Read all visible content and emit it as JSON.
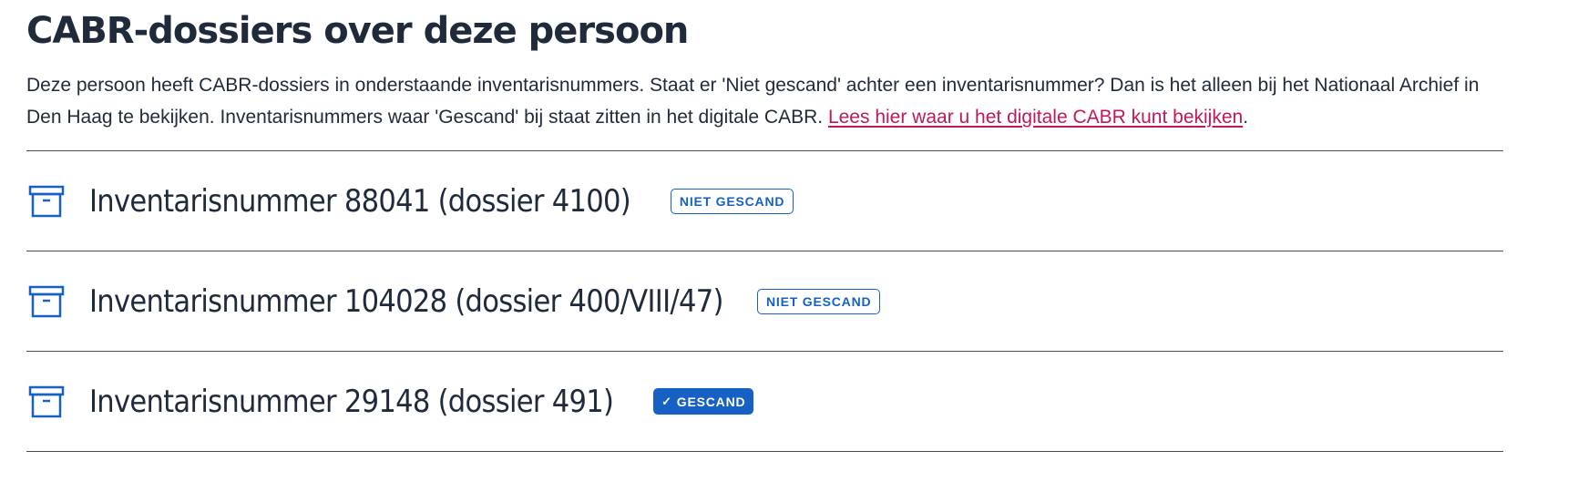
{
  "heading": "CABR-dossiers over deze persoon",
  "intro": {
    "text": "Deze persoon heeft CABR-dossiers in onderstaande inventarisnummers. Staat er 'Niet gescand' achter een inventarisnummer? Dan is het alleen bij het Nationaal Archief in Den Haag te bekijken. Inventarisnummers waar 'Gescand' bij staat zitten in het digitale CABR. ",
    "link_text": "Lees hier waar u het digitale CABR kunt bekijken",
    "suffix": "."
  },
  "dossiers": [
    {
      "title": "Inventarisnummer 88041 (dossier 4100)",
      "status": "NIET GESCAND",
      "scanned": false,
      "icon": "archive-box-icon"
    },
    {
      "title": "Inventarisnummer 104028 (dossier 400/VIII/47)",
      "status": "NIET GESCAND",
      "scanned": false,
      "icon": "archive-box-icon"
    },
    {
      "title": "Inventarisnummer 29148 (dossier 491)",
      "status": "GESCAND",
      "scanned": true,
      "icon": "archive-box-icon"
    }
  ],
  "colors": {
    "text": "#1f2a3a",
    "link": "#c2185b",
    "accent": "#1760c4",
    "divider": "#4a4a4a"
  }
}
